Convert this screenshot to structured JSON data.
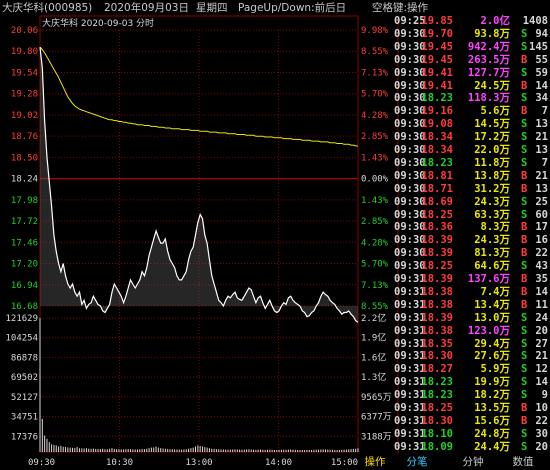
{
  "title": {
    "stock": "大庆华科(000985)",
    "date_text": "2020年09月03日",
    "weekday": "星期四",
    "hint": "PageUp/Down:前后日",
    "hint2": "空格键:操作"
  },
  "chart": {
    "legend_name": "大庆华科",
    "legend_date": "2020-09-03",
    "legend_type": "分时"
  },
  "colors": {
    "up": "#ff3b3b",
    "down": "#22d022",
    "base": "#d8d8d8",
    "price_line": "#ffffff",
    "avg_line": "#e8e800",
    "grid": "#8a0000",
    "volume": "#d8d8d8"
  },
  "chart_data": {
    "type": "line",
    "base_price": 18.24,
    "price_axis": {
      "ticks": [
        "20.06",
        "19.80",
        "19.54",
        "19.28",
        "19.02",
        "18.76",
        "18.50",
        "18.24",
        "17.98",
        "17.72",
        "17.46",
        "17.20",
        "16.94",
        "16.68"
      ],
      "values": [
        20.06,
        19.8,
        19.54,
        19.28,
        19.02,
        18.76,
        18.5,
        18.24,
        17.98,
        17.72,
        17.46,
        17.2,
        16.94,
        16.68
      ]
    },
    "pct_axis": [
      "9.98%",
      "8.55%",
      "7.13%",
      "5.70%",
      "4.28%",
      "2.85%",
      "1.43%",
      "0.00%",
      "1.43%",
      "2.85%",
      "4.28%",
      "5.70%",
      "7.13%",
      "8.55%"
    ],
    "volume_axis": {
      "left": [
        "121629",
        "104254",
        "86878",
        "69502",
        "52127",
        "34751",
        "17376"
      ],
      "right": [
        "2.2亿",
        "1.9亿",
        "1.6亿",
        "1.3亿",
        "9565万",
        "6377万",
        "3188万"
      ]
    },
    "x_labels": [
      "09:30",
      "10:30",
      "13:00",
      "14:00",
      "15:00"
    ],
    "price": [
      19.85,
      19.6,
      18.95,
      18.5,
      18.2,
      17.9,
      17.55,
      17.35,
      17.2,
      17.1,
      17.2,
      17.05,
      16.95,
      16.9,
      16.95,
      16.85,
      16.8,
      16.85,
      16.7,
      16.75,
      16.65,
      16.7,
      16.72,
      16.8,
      16.75,
      16.7,
      16.68,
      16.62,
      16.6,
      16.65,
      16.7,
      16.85,
      16.95,
      16.9,
      16.85,
      16.8,
      16.72,
      16.8,
      16.9,
      17.0,
      16.95,
      16.9,
      16.95,
      17.0,
      17.1,
      17.05,
      17.15,
      17.3,
      17.4,
      17.5,
      17.6,
      17.52,
      17.45,
      17.45,
      17.5,
      17.35,
      17.25,
      17.2,
      17.15,
      17.05,
      17.0,
      17.0,
      17.05,
      17.1,
      17.25,
      17.35,
      17.4,
      17.55,
      17.7,
      17.8,
      17.75,
      17.55,
      17.45,
      17.25,
      17.05,
      16.95,
      16.85,
      16.75,
      16.72,
      16.68,
      16.75,
      16.8,
      16.78,
      16.82,
      16.85,
      16.78,
      16.76,
      16.75,
      16.8,
      16.85,
      16.9,
      16.88,
      16.8,
      16.72,
      16.78,
      16.8,
      16.72,
      16.65,
      16.7,
      16.75,
      16.68,
      16.62,
      16.6,
      16.62,
      16.68,
      16.72,
      16.7,
      16.78,
      16.8,
      16.75,
      16.72,
      16.7,
      16.68,
      16.62,
      16.6,
      16.55,
      16.56,
      16.6,
      16.62,
      16.68,
      16.72,
      16.8,
      16.85,
      16.82,
      16.8,
      16.75,
      16.72,
      16.7,
      16.65,
      16.62,
      16.58,
      16.6,
      16.6,
      16.62,
      16.58,
      16.55,
      16.5,
      16.48
    ],
    "avg": [
      19.85,
      19.82,
      19.78,
      19.73,
      19.68,
      19.63,
      19.58,
      19.53,
      19.48,
      19.42,
      19.36,
      19.3,
      19.24,
      19.2,
      19.16,
      19.13,
      19.11,
      19.09,
      19.08,
      19.07,
      19.06,
      19.05,
      19.04,
      19.03,
      19.02,
      19.01,
      19.0,
      18.99,
      18.98,
      18.97,
      18.96,
      18.96,
      18.95,
      18.95,
      18.94,
      18.94,
      18.93,
      18.93,
      18.92,
      18.92,
      18.91,
      18.91,
      18.9,
      18.9,
      18.9,
      18.89,
      18.89,
      18.89,
      18.88,
      18.88,
      18.88,
      18.87,
      18.87,
      18.87,
      18.86,
      18.86,
      18.86,
      18.85,
      18.85,
      18.85,
      18.85,
      18.84,
      18.84,
      18.84,
      18.84,
      18.83,
      18.83,
      18.83,
      18.83,
      18.82,
      18.82,
      18.82,
      18.82,
      18.81,
      18.81,
      18.81,
      18.81,
      18.8,
      18.8,
      18.8,
      18.8,
      18.79,
      18.79,
      18.79,
      18.79,
      18.78,
      18.78,
      18.78,
      18.78,
      18.77,
      18.77,
      18.77,
      18.77,
      18.76,
      18.76,
      18.76,
      18.76,
      18.75,
      18.75,
      18.75,
      18.75,
      18.74,
      18.74,
      18.74,
      18.74,
      18.73,
      18.73,
      18.73,
      18.73,
      18.72,
      18.72,
      18.72,
      18.72,
      18.71,
      18.71,
      18.71,
      18.71,
      18.7,
      18.7,
      18.7,
      18.7,
      18.69,
      18.69,
      18.69,
      18.69,
      18.68,
      18.68,
      18.68,
      18.67,
      18.67,
      18.67,
      18.66,
      18.66,
      18.66,
      18.65,
      18.65,
      18.64,
      18.64
    ],
    "volume_max": 121629,
    "volume": [
      121629,
      30000,
      15000,
      12000,
      9000,
      7000,
      6500,
      6000,
      5000,
      5500,
      4800,
      4500,
      4200,
      4000,
      3800,
      3600,
      4500,
      3400,
      3300,
      3200,
      3500,
      3000,
      2900,
      3100,
      2800,
      2700,
      2600,
      3000,
      2500,
      2400,
      3000,
      3500,
      2800,
      2600,
      2500,
      2400,
      2300,
      2600,
      2700,
      2500,
      2400,
      2300,
      2200,
      2500,
      2800,
      2600,
      3000,
      3500,
      4000,
      4200,
      5000,
      4000,
      3500,
      3200,
      3000,
      2800,
      2600,
      2500,
      2400,
      2300,
      2200,
      2100,
      2300,
      2500,
      3000,
      3500,
      4000,
      5000,
      6000,
      5500,
      5000,
      4500,
      4000,
      3500,
      3000,
      2800,
      2600,
      2500,
      2400,
      2300,
      2200,
      2100,
      2200,
      2300,
      2400,
      2200,
      2100,
      2000,
      2200,
      2300,
      2400,
      2200,
      2100,
      2000,
      2100,
      2200,
      2000,
      1900,
      2000,
      2100,
      2000,
      1900,
      1800,
      1900,
      2000,
      2100,
      2000,
      2200,
      2300,
      2100,
      2000,
      1900,
      1800,
      1900,
      1800,
      1700,
      1800,
      1900,
      2000,
      2100,
      2200,
      2300,
      2400,
      2300,
      2200,
      2100,
      2000,
      1900,
      1800,
      1900,
      2000,
      2100,
      2200,
      2400,
      2600,
      2800,
      3000,
      3500
    ]
  },
  "ticks": [
    {
      "time": "09:25",
      "price": "19.85",
      "vol": "2.0亿",
      "bs": "",
      "cnt": "1408",
      "pc": "red",
      "vc": "mag"
    },
    {
      "time": "09:30",
      "price": "19.70",
      "vol": "93.8万",
      "bs": "S",
      "cnt": "94",
      "pc": "red",
      "vc": "yel"
    },
    {
      "time": "09:30",
      "price": "19.45",
      "vol": "942.4万",
      "bs": "S",
      "cnt": "145",
      "pc": "red",
      "vc": "mag"
    },
    {
      "time": "09:30",
      "price": "19.45",
      "vol": "263.5万",
      "bs": "B",
      "cnt": "55",
      "pc": "red",
      "vc": "mag"
    },
    {
      "time": "09:30",
      "price": "19.41",
      "vol": "127.7万",
      "bs": "S",
      "cnt": "59",
      "pc": "red",
      "vc": "mag"
    },
    {
      "time": "09:30",
      "price": "19.41",
      "vol": "24.5万",
      "bs": "B",
      "cnt": "14",
      "pc": "red",
      "vc": "yel"
    },
    {
      "time": "09:30",
      "price": "18.23",
      "vol": "118.3万",
      "bs": "S",
      "cnt": "34",
      "pc": "green",
      "vc": "mag"
    },
    {
      "time": "09:30",
      "price": "19.16",
      "vol": "5.6万",
      "bs": "B",
      "cnt": "7",
      "pc": "red",
      "vc": "yel"
    },
    {
      "time": "09:30",
      "price": "19.08",
      "vol": "14.5万",
      "bs": "S",
      "cnt": "13",
      "pc": "red",
      "vc": "yel"
    },
    {
      "time": "09:30",
      "price": "18.34",
      "vol": "17.2万",
      "bs": "S",
      "cnt": "21",
      "pc": "red",
      "vc": "yel"
    },
    {
      "time": "09:30",
      "price": "18.34",
      "vol": "22.0万",
      "bs": "S",
      "cnt": "13",
      "pc": "red",
      "vc": "yel"
    },
    {
      "time": "09:30",
      "price": "18.23",
      "vol": "11.8万",
      "bs": "S",
      "cnt": "7",
      "pc": "green",
      "vc": "yel"
    },
    {
      "time": "09:30",
      "price": "18.81",
      "vol": "13.8万",
      "bs": "B",
      "cnt": "21",
      "pc": "red",
      "vc": "yel"
    },
    {
      "time": "09:30",
      "price": "18.71",
      "vol": "31.2万",
      "bs": "B",
      "cnt": "13",
      "pc": "red",
      "vc": "yel"
    },
    {
      "time": "09:30",
      "price": "18.69",
      "vol": "24.3万",
      "bs": "S",
      "cnt": "25",
      "pc": "red",
      "vc": "yel"
    },
    {
      "time": "09:30",
      "price": "18.25",
      "vol": "63.3万",
      "bs": "S",
      "cnt": "60",
      "pc": "red",
      "vc": "yel"
    },
    {
      "time": "09:30",
      "price": "18.36",
      "vol": "8.3万",
      "bs": "B",
      "cnt": "17",
      "pc": "red",
      "vc": "yel"
    },
    {
      "time": "09:30",
      "price": "18.39",
      "vol": "24.3万",
      "bs": "B",
      "cnt": "16",
      "pc": "red",
      "vc": "yel"
    },
    {
      "time": "09:30",
      "price": "18.39",
      "vol": "81.3万",
      "bs": "B",
      "cnt": "22",
      "pc": "red",
      "vc": "yel"
    },
    {
      "time": "09:30",
      "price": "18.25",
      "vol": "64.6万",
      "bs": "S",
      "cnt": "43",
      "pc": "red",
      "vc": "yel"
    },
    {
      "time": "09:31",
      "price": "18.39",
      "vol": "137.6万",
      "bs": "B",
      "cnt": "35",
      "pc": "red",
      "vc": "mag"
    },
    {
      "time": "09:31",
      "price": "18.38",
      "vol": "7.4万",
      "bs": "B",
      "cnt": "14",
      "pc": "red",
      "vc": "yel"
    },
    {
      "time": "09:31",
      "price": "18.38",
      "vol": "13.4万",
      "bs": "B",
      "cnt": "11",
      "pc": "red",
      "vc": "yel"
    },
    {
      "time": "09:31",
      "price": "18.39",
      "vol": "13.0万",
      "bs": "S",
      "cnt": "24",
      "pc": "red",
      "vc": "yel"
    },
    {
      "time": "09:31",
      "price": "18.38",
      "vol": "123.0万",
      "bs": "S",
      "cnt": "20",
      "pc": "red",
      "vc": "mag"
    },
    {
      "time": "09:31",
      "price": "18.35",
      "vol": "29.4万",
      "bs": "S",
      "cnt": "27",
      "pc": "red",
      "vc": "yel"
    },
    {
      "time": "09:31",
      "price": "18.30",
      "vol": "27.6万",
      "bs": "S",
      "cnt": "21",
      "pc": "red",
      "vc": "yel"
    },
    {
      "time": "09:31",
      "price": "18.27",
      "vol": "5.9万",
      "bs": "S",
      "cnt": "12",
      "pc": "red",
      "vc": "yel"
    },
    {
      "time": "09:31",
      "price": "18.23",
      "vol": "19.9万",
      "bs": "S",
      "cnt": "14",
      "pc": "green",
      "vc": "yel"
    },
    {
      "time": "09:31",
      "price": "18.23",
      "vol": "18.2万",
      "bs": "S",
      "cnt": "9",
      "pc": "green",
      "vc": "yel"
    },
    {
      "time": "09:31",
      "price": "18.25",
      "vol": "13.5万",
      "bs": "B",
      "cnt": "10",
      "pc": "red",
      "vc": "yel"
    },
    {
      "time": "09:31",
      "price": "18.30",
      "vol": "15.6万",
      "bs": "B",
      "cnt": "22",
      "pc": "red",
      "vc": "yel"
    },
    {
      "time": "09:31",
      "price": "18.10",
      "vol": "24.8万",
      "bs": "S",
      "cnt": "30",
      "pc": "green",
      "vc": "yel"
    },
    {
      "time": "09:31",
      "price": "18.09",
      "vol": "24.4万",
      "bs": "S",
      "cnt": "20",
      "pc": "green",
      "vc": "yel"
    }
  ],
  "tabs": {
    "operate": "操作",
    "fenbi": "分笔",
    "fenzhong": "分钟",
    "shuju": "数值"
  }
}
